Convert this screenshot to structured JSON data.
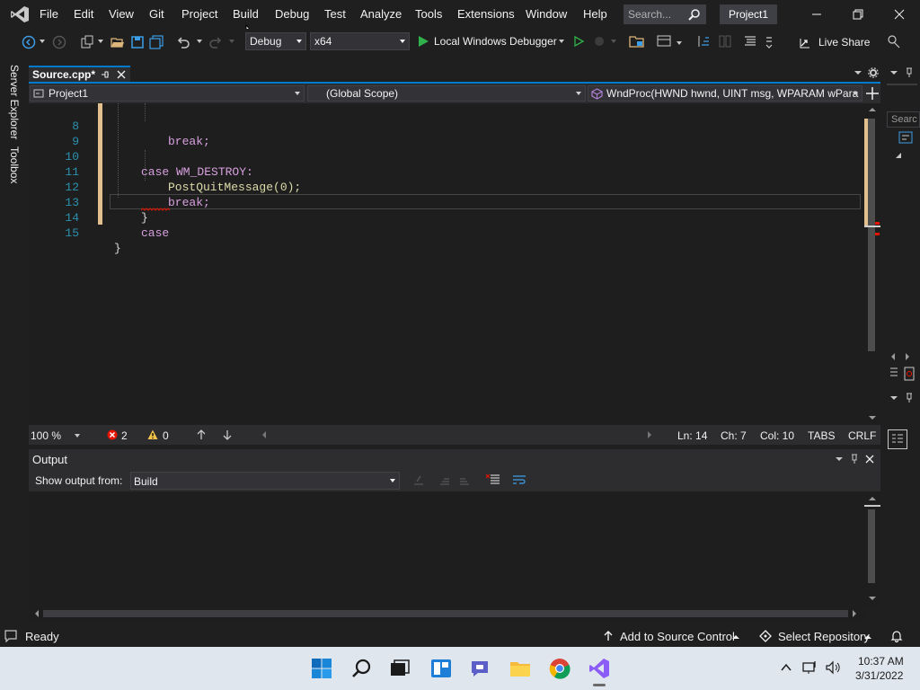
{
  "menu": {
    "items": [
      "File",
      "Edit",
      "View",
      "Git",
      "Project",
      "Build",
      "Debug",
      "Test",
      "Analyze",
      "Tools",
      "Extensions",
      "Window",
      "Help"
    ]
  },
  "search": {
    "placeholder": "Search..."
  },
  "project_badge": "Project1",
  "toolbar": {
    "configuration": "Debug",
    "platform": "x64",
    "run_label": "Local Windows Debugger",
    "live_share": "Live Share"
  },
  "side_tabs": {
    "server_explorer": "Server Explorer",
    "toolbox": "Toolbox"
  },
  "document_tab": {
    "title": "Source.cpp*"
  },
  "nav": {
    "project": "Project1",
    "scope": "(Global Scope)",
    "member": "WndProc(HWND hwnd, UINT msg, WPARAM wPara"
  },
  "code": {
    "lines": [
      {
        "number": "8",
        "text": "break;"
      },
      {
        "number": "9",
        "text": ""
      },
      {
        "number": "10",
        "text": "case WM_DESTROY:"
      },
      {
        "number": "11",
        "text": "PostQuitMessage(0);"
      },
      {
        "number": "12",
        "text": "break;"
      },
      {
        "number": "13",
        "text": "}"
      },
      {
        "number": "14",
        "text": "case"
      },
      {
        "number": "15",
        "text": "}"
      }
    ]
  },
  "editor_status": {
    "zoom": "100 %",
    "errors": "2",
    "warnings": "0",
    "line": "Ln: 14",
    "char": "Ch: 7",
    "col": "Col: 10",
    "tabs": "TABS",
    "eol": "CRLF"
  },
  "output": {
    "title": "Output",
    "show_from_label": "Show output from:",
    "source": "Build"
  },
  "right_strip": {
    "search": "Searc"
  },
  "statusbar": {
    "ready": "Ready",
    "source_control": "Add to Source Control",
    "repository": "Select Repository"
  },
  "taskbar": {
    "time": "10:37 AM",
    "date": "3/31/2022"
  },
  "colors": {
    "accent": "#007acc",
    "background": "#1f1f1f",
    "editor": "#1e1e1e",
    "line_number": "#2b91af",
    "keyword": "#d8a0df",
    "function": "#dcdcaa",
    "modified_marker": "#e2c08d",
    "error": "#e51400"
  }
}
